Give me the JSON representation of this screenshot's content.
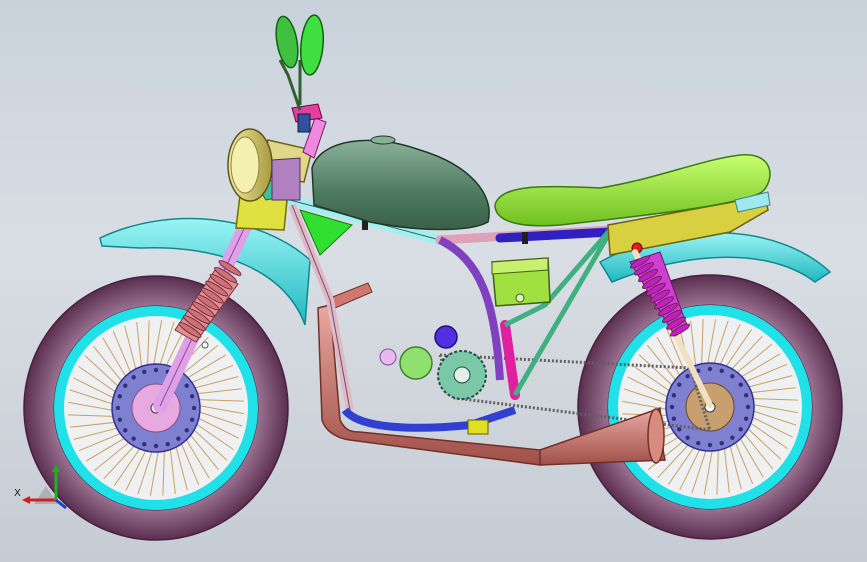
{
  "viewport": {
    "background_top": "#c9d2dc",
    "background_bottom": "#c6ccd4"
  },
  "model": {
    "parts": [
      "front-wheel",
      "rear-wheel",
      "front-fender",
      "rear-fender",
      "fork",
      "fork-spring",
      "headlight",
      "mirror",
      "handlebar",
      "fuel-tank",
      "seat",
      "frame",
      "engine-sprocket",
      "drive-chain",
      "rear-shock",
      "exhaust",
      "battery",
      "footpeg"
    ],
    "colors": {
      "tire": "#8a5a78",
      "rim": "#20e0e8",
      "hub": "#8080d0",
      "spokes": "#c8a060",
      "fender": "#40d8d8",
      "fork": "#e0a0e8",
      "fork_spring": "#e09090",
      "headlight": "#d8d080",
      "mirror": "#40d040",
      "tank": "#508060",
      "seat": "#90e030",
      "seat_base": "#d0d040",
      "frame_cyan": "#a0f0f0",
      "frame_pink": "#e0a0b8",
      "frame_purple": "#8040c0",
      "frame_green": "#40b080",
      "frame_magenta": "#e020a0",
      "exhaust": "#c07068",
      "shock": "#c020c0",
      "battery": "#a0e040",
      "sprocket": "#50b090",
      "chain": "#707070"
    }
  },
  "triad": {
    "x_label": "X",
    "y_label": "",
    "x_color": "#d02020",
    "y_color": "#20b020",
    "z_color": "#2040d0"
  }
}
